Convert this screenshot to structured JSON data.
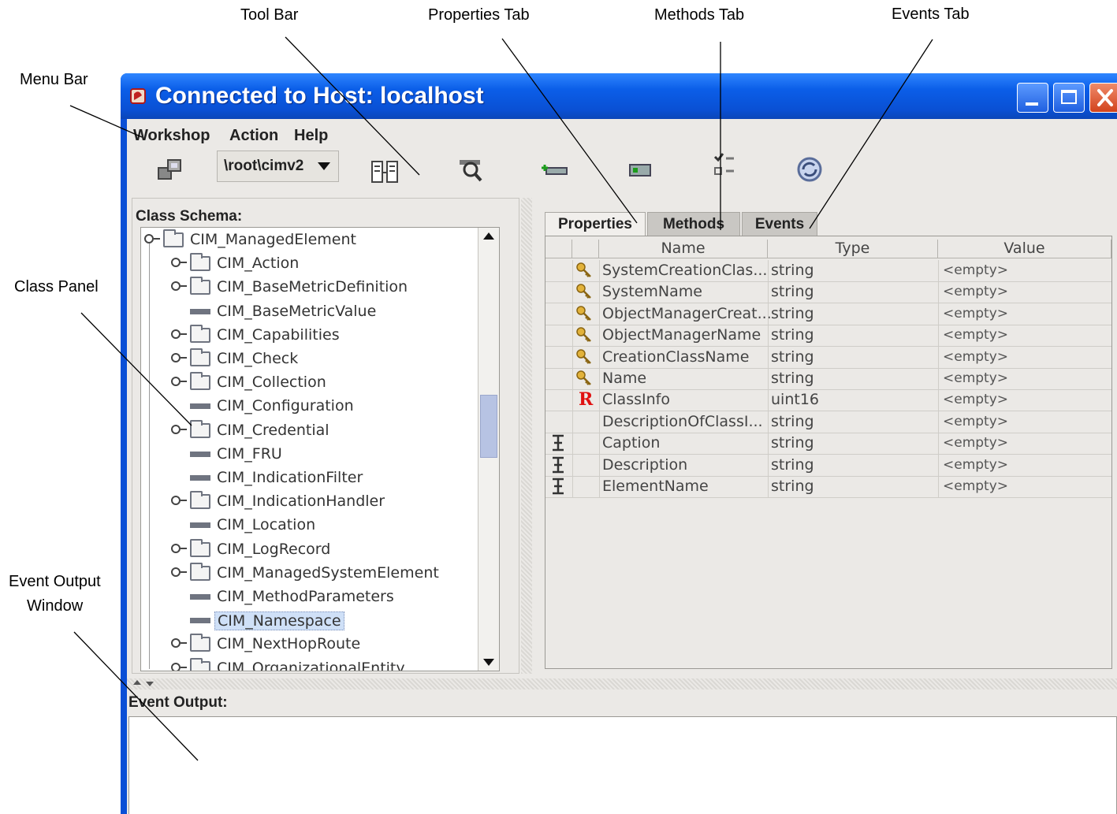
{
  "callouts": {
    "tool_bar": "Tool Bar",
    "properties_tab": "Properties Tab",
    "methods_tab": "Methods Tab",
    "events_tab": "Events Tab",
    "menu_bar": "Menu Bar",
    "class_panel": "Class Panel",
    "event_output_window_line1": "Event Output",
    "event_output_window_line2": "Window"
  },
  "window": {
    "title": "Connected to Host: localhost",
    "title_bar_color": "#0a50d4"
  },
  "menu": [
    "Workshop",
    "Action",
    "Help"
  ],
  "toolbar": {
    "namespace": "\\root\\cimv2",
    "icons": [
      "connect-icon",
      "namespace-dropdown",
      "class-view-icon",
      "search-icon",
      "add-icon",
      "instance-icon",
      "checklist-icon",
      "refresh-icon"
    ]
  },
  "class_panel": {
    "label": "Class Schema:",
    "tree": [
      {
        "label": "CIM_ManagedElement",
        "type": "folder",
        "level": 0,
        "expanded": true
      },
      {
        "label": "CIM_Action",
        "type": "folder",
        "level": 1
      },
      {
        "label": "CIM_BaseMetricDefinition",
        "type": "folder",
        "level": 1
      },
      {
        "label": "CIM_BaseMetricValue",
        "type": "leaf",
        "level": 1
      },
      {
        "label": "CIM_Capabilities",
        "type": "folder",
        "level": 1
      },
      {
        "label": "CIM_Check",
        "type": "folder",
        "level": 1
      },
      {
        "label": "CIM_Collection",
        "type": "folder",
        "level": 1
      },
      {
        "label": "CIM_Configuration",
        "type": "leaf",
        "level": 1
      },
      {
        "label": "CIM_Credential",
        "type": "folder",
        "level": 1
      },
      {
        "label": "CIM_FRU",
        "type": "leaf",
        "level": 1
      },
      {
        "label": "CIM_IndicationFilter",
        "type": "leaf",
        "level": 1
      },
      {
        "label": "CIM_IndicationHandler",
        "type": "folder",
        "level": 1
      },
      {
        "label": "CIM_Location",
        "type": "leaf",
        "level": 1
      },
      {
        "label": "CIM_LogRecord",
        "type": "folder",
        "level": 1
      },
      {
        "label": "CIM_ManagedSystemElement",
        "type": "folder",
        "level": 1
      },
      {
        "label": "CIM_MethodParameters",
        "type": "leaf",
        "level": 1
      },
      {
        "label": "CIM_Namespace",
        "type": "leaf",
        "level": 1,
        "selected": true
      },
      {
        "label": "CIM_NextHopRoute",
        "type": "folder",
        "level": 1
      },
      {
        "label": "CIM_OrganizationalEntity",
        "type": "folder",
        "level": 1
      }
    ]
  },
  "tabs": {
    "properties": "Properties",
    "methods": "Methods",
    "events": "Events"
  },
  "properties_table": {
    "headers": {
      "name": "Name",
      "type": "Type",
      "value": "Value"
    },
    "rows": [
      {
        "icon": "key",
        "inherited": false,
        "name": "SystemCreationClas...",
        "type": "string",
        "value": "<empty>"
      },
      {
        "icon": "key",
        "inherited": false,
        "name": "SystemName",
        "type": "string",
        "value": "<empty>"
      },
      {
        "icon": "key",
        "inherited": false,
        "name": "ObjectManagerCreat...",
        "type": "string",
        "value": "<empty>"
      },
      {
        "icon": "key",
        "inherited": false,
        "name": "ObjectManagerName",
        "type": "string",
        "value": "<empty>"
      },
      {
        "icon": "key",
        "inherited": false,
        "name": "CreationClassName",
        "type": "string",
        "value": "<empty>"
      },
      {
        "icon": "key",
        "inherited": false,
        "name": "Name",
        "type": "string",
        "value": "<empty>"
      },
      {
        "icon": "required",
        "inherited": false,
        "name": "ClassInfo",
        "type": "uint16",
        "value": "<empty>"
      },
      {
        "icon": "",
        "inherited": false,
        "name": "DescriptionOfClassI...",
        "type": "string",
        "value": "<empty>"
      },
      {
        "icon": "",
        "inherited": true,
        "name": "Caption",
        "type": "string",
        "value": "<empty>"
      },
      {
        "icon": "",
        "inherited": true,
        "name": "Description",
        "type": "string",
        "value": "<empty>"
      },
      {
        "icon": "",
        "inherited": true,
        "name": "ElementName",
        "type": "string",
        "value": "<empty>"
      }
    ],
    "required_marker": "R"
  },
  "event_output": {
    "label": "Event Output:",
    "content": ""
  }
}
